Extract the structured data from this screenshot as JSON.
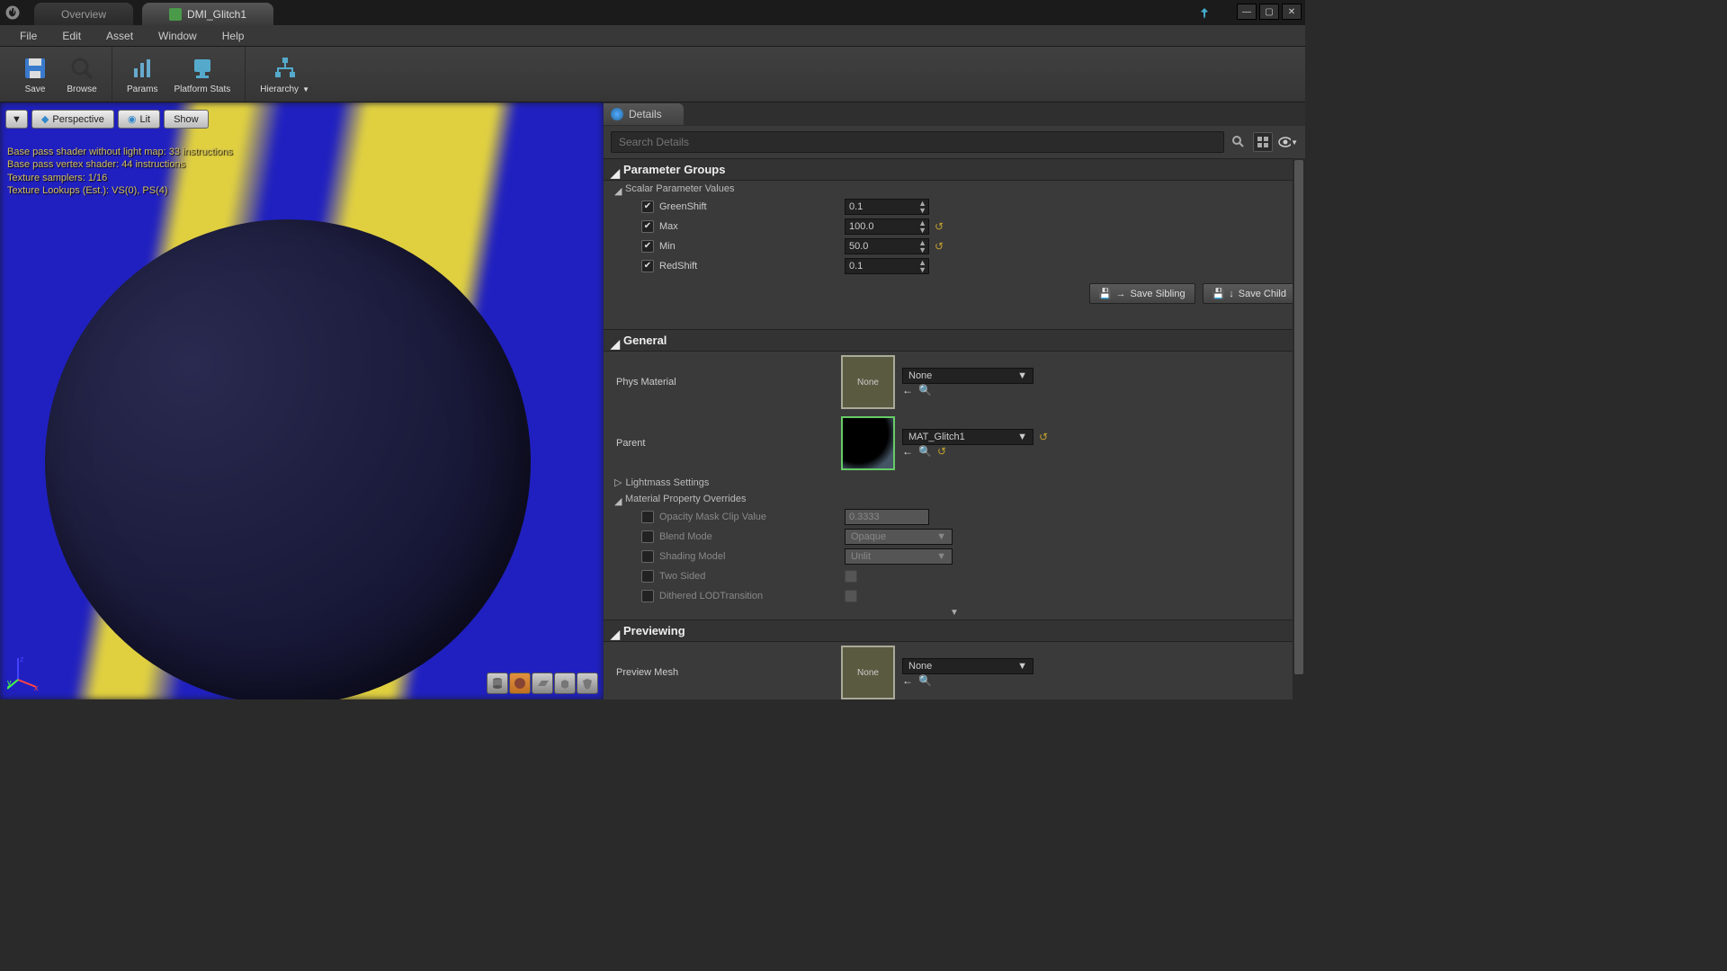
{
  "tabs": {
    "overview": "Overview",
    "asset": "DMI_Glitch1"
  },
  "menu": {
    "file": "File",
    "edit": "Edit",
    "asset": "Asset",
    "window": "Window",
    "help": "Help"
  },
  "toolbar": {
    "save": "Save",
    "browse": "Browse",
    "params": "Params",
    "platform": "Platform Stats",
    "hierarchy": "Hierarchy"
  },
  "viewport": {
    "perspective": "Perspective",
    "lit": "Lit",
    "show": "Show",
    "stat1": "Base pass shader without light map: 33 instructions",
    "stat2": "Base pass vertex shader: 44 instructions",
    "stat3": "Texture samplers: 1/16",
    "stat4": "Texture Lookups (Est.): VS(0), PS(4)"
  },
  "details": {
    "title": "Details",
    "search_placeholder": "Search Details",
    "cat_params": "Parameter Groups",
    "sub_scalar": "Scalar Parameter Values",
    "greenshift": "GreenShift",
    "greenshift_v": "0.1",
    "max": "Max",
    "max_v": "100.0",
    "min": "Min",
    "min_v": "50.0",
    "redshift": "RedShift",
    "redshift_v": "0.1",
    "save_sibling": "Save Sibling",
    "save_child": "Save Child",
    "cat_general": "General",
    "phys": "Phys Material",
    "none": "None",
    "parent": "Parent",
    "parent_v": "MAT_Glitch1",
    "lightmass": "Lightmass Settings",
    "overrides": "Material Property Overrides",
    "opmask": "Opacity Mask Clip Value",
    "opmask_v": "0.3333",
    "blend": "Blend Mode",
    "blend_v": "Opaque",
    "shading": "Shading Model",
    "shading_v": "Unlit",
    "twosided": "Two Sided",
    "dithered": "Dithered LODTransition",
    "cat_preview": "Previewing",
    "preview_mesh": "Preview Mesh"
  }
}
